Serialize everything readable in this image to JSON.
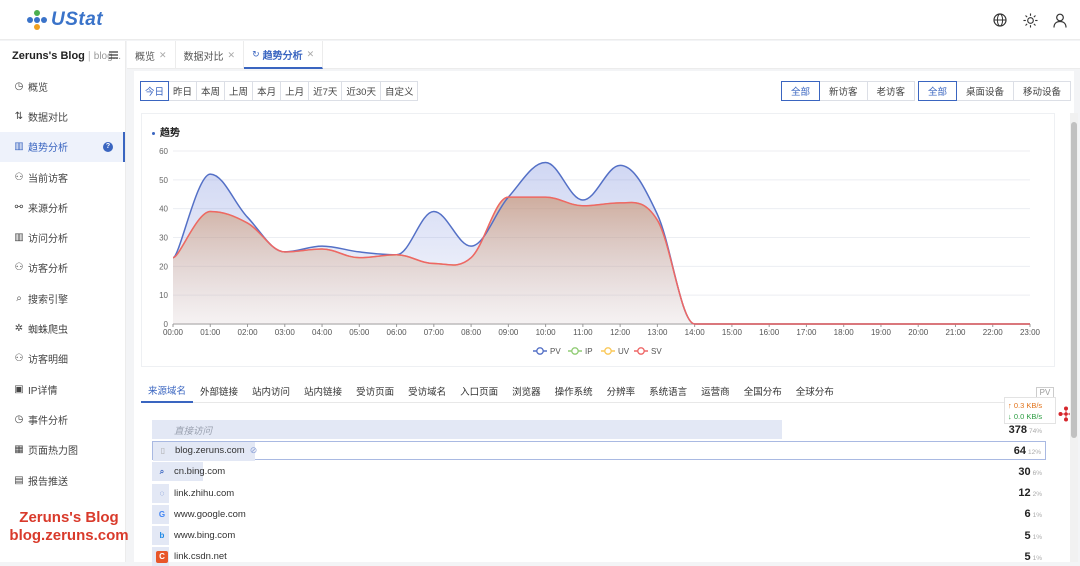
{
  "app": {
    "logo_text": "UStat"
  },
  "header_icons": [
    "globe-icon",
    "sun-icon",
    "user-icon"
  ],
  "sidebar": {
    "site_name": "Zeruns's Blog",
    "site_sub": "blog...",
    "items": [
      {
        "label": "概览",
        "icon": "dashboard-icon"
      },
      {
        "label": "数据对比",
        "icon": "compare-icon"
      },
      {
        "label": "趋势分析",
        "icon": "trend-icon",
        "active": true
      },
      {
        "label": "当前访客",
        "icon": "user-icon"
      },
      {
        "label": "来源分析",
        "icon": "share-icon"
      },
      {
        "label": "访问分析",
        "icon": "bar-chart-icon"
      },
      {
        "label": "访客分析",
        "icon": "users-icon"
      },
      {
        "label": "搜索引擎",
        "icon": "search-icon"
      },
      {
        "label": "蜘蛛爬虫",
        "icon": "bug-icon"
      },
      {
        "label": "访客明细",
        "icon": "user-detail-icon"
      },
      {
        "label": "IP详情",
        "icon": "ip-icon"
      },
      {
        "label": "事件分析",
        "icon": "clock-icon"
      },
      {
        "label": "页面热力图",
        "icon": "heatmap-icon"
      },
      {
        "label": "报告推送",
        "icon": "report-icon"
      }
    ]
  },
  "watermark": {
    "line1": "Zeruns's Blog",
    "line2": "blog.zeruns.com"
  },
  "tabs": [
    {
      "label": "概览"
    },
    {
      "label": "数据对比"
    },
    {
      "label": "趋势分析",
      "active": true
    }
  ],
  "date_filters": [
    "今日",
    "昨日",
    "本周",
    "上周",
    "本月",
    "上月",
    "近7天",
    "近30天",
    "自定义"
  ],
  "visitor_filters": [
    "全部",
    "新访客",
    "老访客"
  ],
  "device_filters": [
    "全部",
    "桌面设备",
    "移动设备"
  ],
  "chart_title": "趋势",
  "chart_data": {
    "type": "area",
    "x": [
      "00:00",
      "01:00",
      "02:00",
      "03:00",
      "04:00",
      "05:00",
      "06:00",
      "07:00",
      "08:00",
      "09:00",
      "10:00",
      "11:00",
      "12:00",
      "13:00",
      "14:00",
      "15:00",
      "16:00",
      "17:00",
      "18:00",
      "19:00",
      "20:00",
      "21:00",
      "22:00",
      "23:00"
    ],
    "ylim": [
      0,
      60
    ],
    "yticks": [
      0,
      10,
      20,
      30,
      40,
      50,
      60
    ],
    "series": [
      {
        "name": "PV",
        "color": "#5470c6",
        "values": [
          23,
          52,
          37,
          25,
          27,
          25,
          24,
          39,
          27,
          44,
          56,
          43,
          55,
          38,
          0,
          0,
          0,
          0,
          0,
          0,
          0,
          0,
          0,
          0
        ]
      },
      {
        "name": "IP",
        "color": "#91cc75",
        "values": [
          23,
          39,
          35,
          25,
          26,
          23,
          24,
          21,
          23,
          44,
          44,
          41,
          42,
          36,
          0,
          0,
          0,
          0,
          0,
          0,
          0,
          0,
          0,
          0
        ]
      },
      {
        "name": "UV",
        "color": "#fac858",
        "values": [
          23,
          39,
          35,
          25,
          26,
          23,
          24,
          21,
          23,
          44,
          44,
          41,
          42,
          36,
          0,
          0,
          0,
          0,
          0,
          0,
          0,
          0,
          0,
          0
        ]
      },
      {
        "name": "SV",
        "color": "#ee6666",
        "values": [
          23,
          39,
          35,
          25,
          26,
          23,
          24,
          21,
          23,
          44,
          44,
          41,
          42,
          36,
          0,
          0,
          0,
          0,
          0,
          0,
          0,
          0,
          0,
          0
        ]
      }
    ],
    "legend": "bottom-center",
    "grid": true
  },
  "subtabs": [
    "来源域名",
    "外部链接",
    "站内访问",
    "站内链接",
    "受访页面",
    "受访域名",
    "入口页面",
    "浏览器",
    "操作系统",
    "分辨率",
    "系统语言",
    "运营商",
    "全国分布",
    "全球分布"
  ],
  "pv_tag": "PV",
  "speed": {
    "up": "↑ 0.3 KB/s",
    "down": "↓ 0.0 KB/s"
  },
  "sources": [
    {
      "domain": "直接访问",
      "count": "378",
      "pct": "74%",
      "share": 0.74,
      "icon": "none",
      "muted": true
    },
    {
      "domain": "blog.zeruns.com",
      "count": "64",
      "pct": "12%",
      "share": 0.12,
      "icon": "page-icon",
      "link": true,
      "selected": true
    },
    {
      "domain": "cn.bing.com",
      "count": "30",
      "pct": "6%",
      "share": 0.06,
      "icon": "search-icon"
    },
    {
      "domain": "link.zhihu.com",
      "count": "12",
      "pct": "2%",
      "share": 0.02,
      "icon": "zhihu-icon"
    },
    {
      "domain": "www.google.com",
      "count": "6",
      "pct": "1%",
      "share": 0.01,
      "icon": "google-icon"
    },
    {
      "domain": "www.bing.com",
      "count": "5",
      "pct": "1%",
      "share": 0.01,
      "icon": "bing-icon"
    },
    {
      "domain": "link.csdn.net",
      "count": "5",
      "pct": "1%",
      "share": 0.01,
      "icon": "csdn-icon"
    }
  ]
}
